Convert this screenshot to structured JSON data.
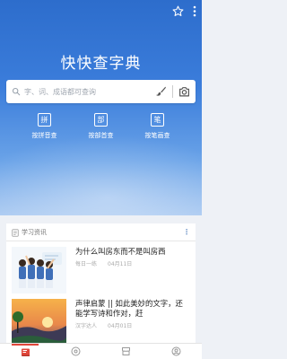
{
  "app": {
    "title": "快快查字典"
  },
  "search": {
    "placeholder": "字、词、成语都可查询"
  },
  "modes": [
    {
      "icon_char": "拼",
      "label": "按拼音查"
    },
    {
      "icon_char": "部",
      "label": "按部首查"
    },
    {
      "icon_char": "笔",
      "label": "按笔画查"
    }
  ],
  "news": {
    "header": "学习资讯",
    "articles": [
      {
        "title": "为什么叫房东而不是叫房西",
        "source": "每日一练",
        "date": "04月11日"
      },
      {
        "title": "声律启蒙 || 如此美妙的文字，还能学写诗和作对，赶",
        "source": "汉字达人",
        "date": "04月01日"
      }
    ]
  },
  "colors": {
    "accent": "#3b7ddb",
    "nav_active": "#e0463a"
  }
}
